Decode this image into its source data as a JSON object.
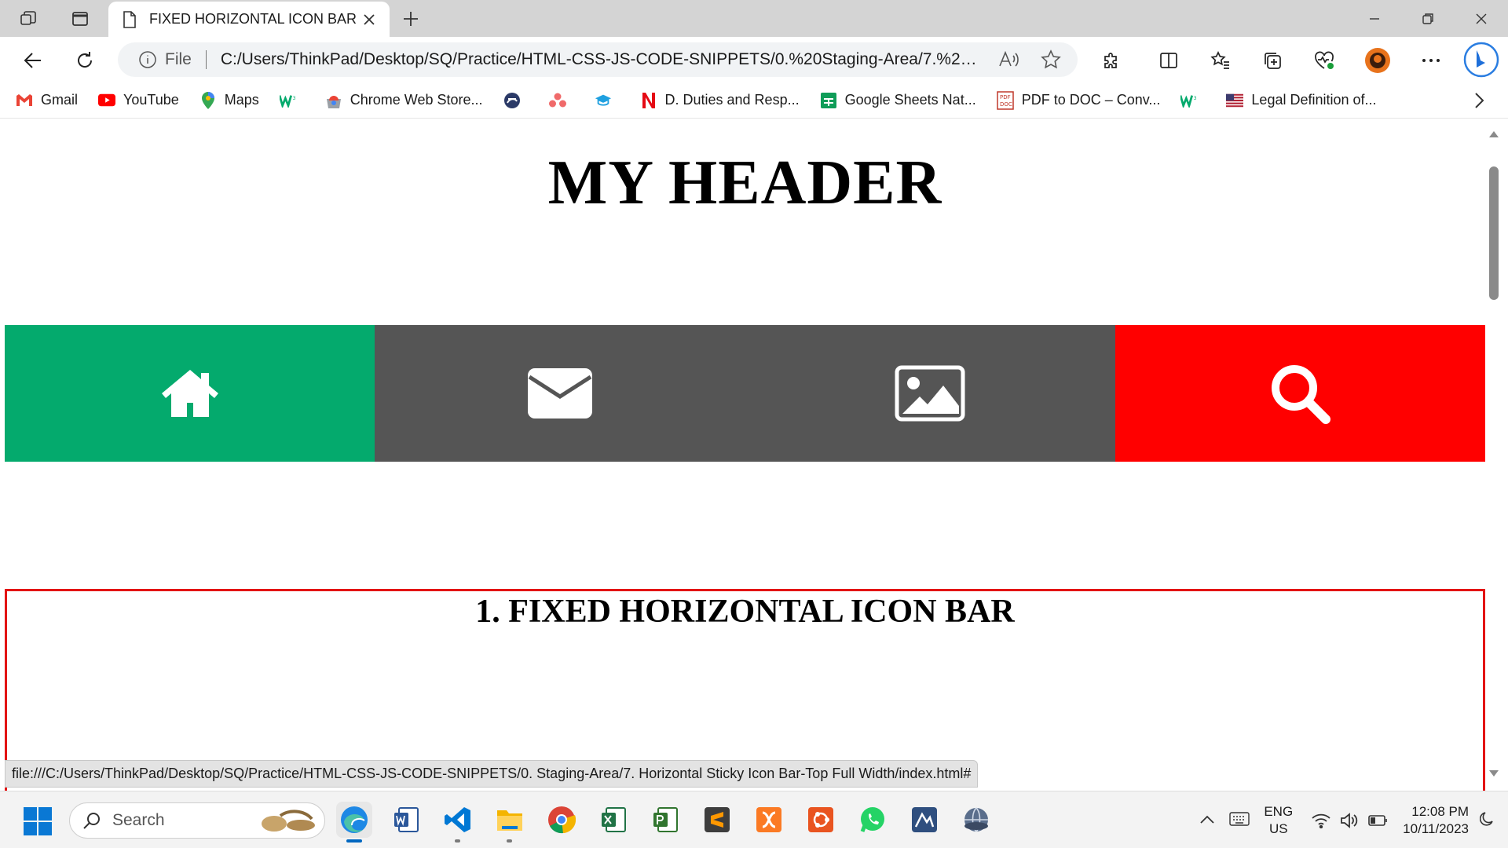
{
  "browser": {
    "tab_title": "FIXED HORIZONTAL ICON BAR",
    "address": {
      "scheme_label": "File",
      "url": "C:/Users/ThinkPad/Desktop/SQ/Practice/HTML-CSS-JS-CODE-SNIPPETS/0.%20Staging-Area/7.%20Hor..."
    },
    "bookmarks": [
      {
        "label": "Gmail",
        "icon": "gmail-icon"
      },
      {
        "label": "YouTube",
        "icon": "youtube-icon"
      },
      {
        "label": "Maps",
        "icon": "maps-icon"
      },
      {
        "label": "",
        "icon": "w3schools-icon"
      },
      {
        "label": "Chrome Web Store...",
        "icon": "chrome-web-store-icon"
      },
      {
        "label": "",
        "icon": "edge-bookmark-icon"
      },
      {
        "label": "",
        "icon": "asana-icon"
      },
      {
        "label": "",
        "icon": "graduation-cap-icon"
      },
      {
        "label": "D. Duties and Resp...",
        "icon": "netflix-n-icon"
      },
      {
        "label": "Google Sheets Nat...",
        "icon": "google-sheets-icon"
      },
      {
        "label": "PDF to DOC – Conv...",
        "icon": "pdf-doc-icon"
      },
      {
        "label": "",
        "icon": "w3schools-icon"
      },
      {
        "label": "Legal Definition of...",
        "icon": "us-flag-icon"
      }
    ]
  },
  "page": {
    "header_title": "MY HEADER",
    "icon_bar": [
      {
        "name": "home",
        "icon": "home-icon",
        "color": "#04AA6D"
      },
      {
        "name": "mail",
        "icon": "envelope-icon",
        "color": "#555555"
      },
      {
        "name": "image",
        "icon": "image-icon",
        "color": "#555555"
      },
      {
        "name": "search",
        "icon": "search-icon",
        "color": "#FF0000"
      }
    ],
    "section_title": "1. FIXED HORIZONTAL ICON BAR",
    "section_border_color": "#e31414",
    "status_url": "file:///C:/Users/ThinkPad/Desktop/SQ/Practice/HTML-CSS-JS-CODE-SNIPPETS/0. Staging-Area/7. Horizontal Sticky Icon Bar-Top Full Width/index.html#"
  },
  "taskbar": {
    "search_label": "Search",
    "apps": [
      "edge-icon",
      "word-icon",
      "vscode-icon",
      "file-explorer-icon",
      "chrome-icon",
      "excel-icon",
      "project-icon",
      "sublime-icon",
      "xampp-icon",
      "ubuntu-icon",
      "whatsapp-icon",
      "ssms-icon",
      "browser-globe-icon"
    ],
    "language_line1": "ENG",
    "language_line2": "US",
    "time": "12:08 PM",
    "date": "10/11/2023"
  }
}
